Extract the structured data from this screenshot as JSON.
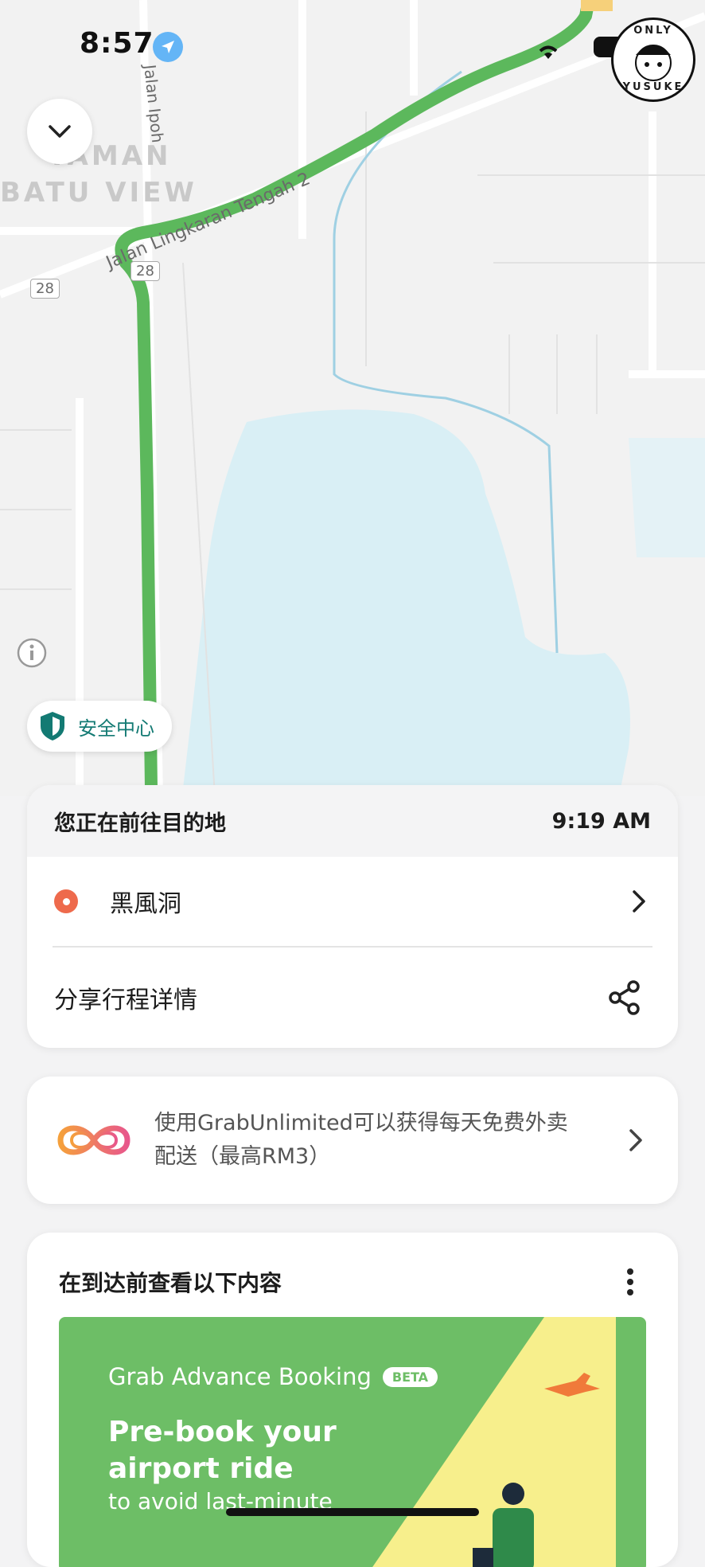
{
  "status_bar": {
    "time": "8:57"
  },
  "watermark": {
    "top_text": "ONLY",
    "bottom_text": "YUSUKE"
  },
  "map": {
    "area_label_1": "TAMAN",
    "area_label_2": "BATU VIEW",
    "road_label": "Jalan Lingkaran Tengah 2",
    "road_label_vertical": "Jalan Ipoh",
    "route_badge_1": "28",
    "route_badge_2": "28",
    "route_color": "#5cb85c",
    "water_color": "#d9eff5"
  },
  "safety_button": {
    "label": "安全中心"
  },
  "trip_card": {
    "header": "您正在前往目的地",
    "eta": "9:19 AM",
    "destination": "黑風洞",
    "share_label": "分享行程详情"
  },
  "promo_card": {
    "text": "使用GrabUnlimited可以获得每天免费外卖配送（最高RM3）"
  },
  "check_card": {
    "title": "在到达前查看以下内容",
    "banner": {
      "brand": "Grab Advance Booking",
      "badge": "BETA",
      "headline": "Pre-book your airport ride",
      "subline": "to avoid last-minute"
    }
  },
  "colors": {
    "accent_green": "#00b14f",
    "safety_teal": "#137a73",
    "destination_dot": "#ee6a4c"
  }
}
